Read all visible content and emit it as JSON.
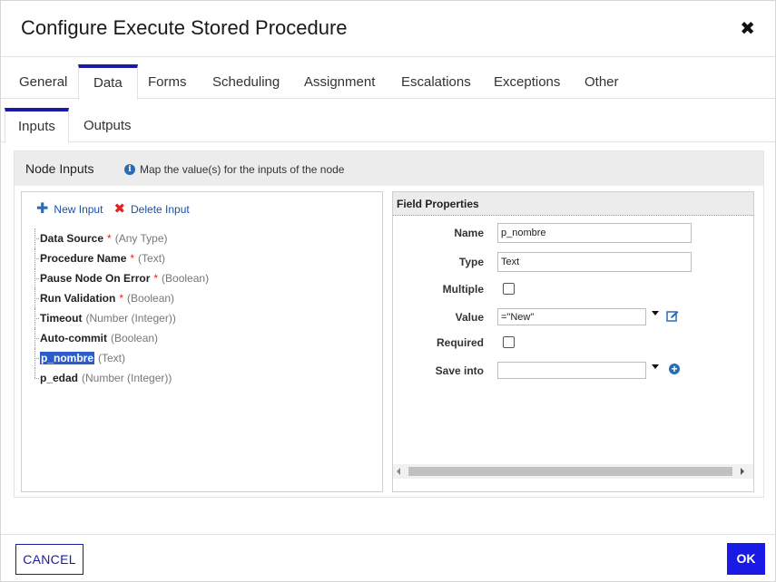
{
  "dialog": {
    "title": "Configure Execute Stored Procedure",
    "close_symbol": "✖"
  },
  "tabs": [
    {
      "label": "General",
      "active": false
    },
    {
      "label": "Data",
      "active": true
    },
    {
      "label": "Forms",
      "active": false
    },
    {
      "label": "Scheduling",
      "active": false
    },
    {
      "label": "Assignment",
      "active": false
    },
    {
      "label": "Escalations",
      "active": false
    },
    {
      "label": "Exceptions",
      "active": false
    },
    {
      "label": "Other",
      "active": false
    }
  ],
  "subtabs": [
    {
      "label": "Inputs",
      "active": true
    },
    {
      "label": "Outputs",
      "active": false
    }
  ],
  "node_inputs": {
    "title": "Node Inputs",
    "info": "Map the value(s) for the inputs of the node",
    "actions": {
      "new_input": "New Input",
      "delete_input": "Delete Input"
    },
    "items": [
      {
        "name": "Data Source",
        "required": "*",
        "type": "(Any Type)"
      },
      {
        "name": "Procedure Name",
        "required": "*",
        "type": "(Text)"
      },
      {
        "name": "Pause Node On Error",
        "required": "*",
        "type": "(Boolean)"
      },
      {
        "name": "Run Validation",
        "required": "*",
        "type": "(Boolean)"
      },
      {
        "name": "Timeout",
        "required": "",
        "type": "(Number (Integer))"
      },
      {
        "name": "Auto-commit",
        "required": "",
        "type": "(Boolean)"
      },
      {
        "name": "p_nombre",
        "required": "",
        "type": "(Text)",
        "selected": true
      },
      {
        "name": "p_edad",
        "required": "",
        "type": "(Number (Integer))"
      }
    ]
  },
  "field_properties": {
    "title": "Field Properties",
    "name_label": "Name",
    "name_value": "p_nombre",
    "type_label": "Type",
    "type_value": "Text",
    "multiple_label": "Multiple",
    "multiple_checked": false,
    "value_label": "Value",
    "value_value": "=\"New\"",
    "required_label": "Required",
    "required_checked": false,
    "save_into_label": "Save into",
    "save_into_value": ""
  },
  "footer": {
    "cancel_label": "CANCEL",
    "ok_label": "OK"
  },
  "colors": {
    "accent": "#1a1aa6",
    "ok_button": "#1a1ae6",
    "selection": "#2b5cc8",
    "required_marker": "#dd2222",
    "link": "#1e4fa3"
  }
}
